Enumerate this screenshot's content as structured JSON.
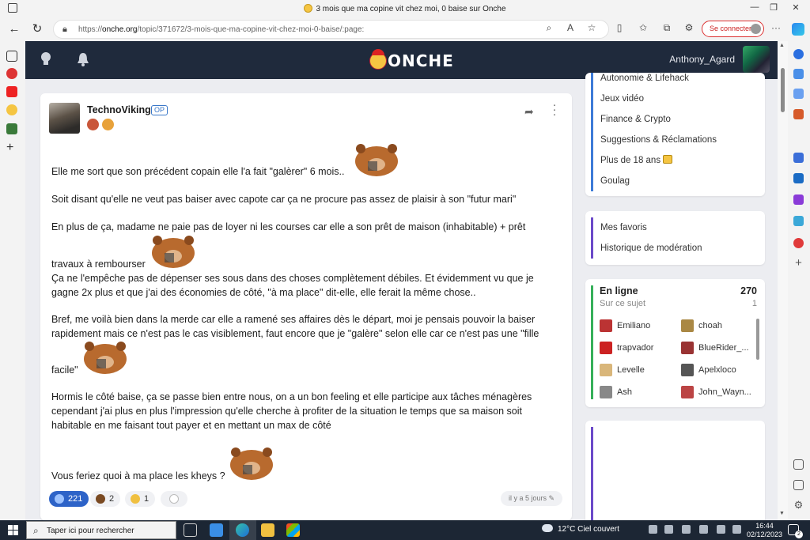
{
  "browser": {
    "window_title": "3 mois que ma copine vit chez moi, 0 baise sur Onche",
    "url_prefix": "https://",
    "url_host": "onche.org",
    "url_path": "/topic/371672/3-mois-que-ma-copine-vit-chez-moi-0-baise/:page:",
    "signin_label": "Se connecter"
  },
  "site": {
    "logo_text": "ONCHE",
    "username": "Anthony_Agard"
  },
  "post": {
    "author": "TechnoViking",
    "op_badge": "OP",
    "paragraphs": [
      "Elle me sort que son précédent copain elle l'a fait \"galèrer\" 6 mois..",
      "Soit disant qu'elle ne veut pas baiser avec capote car ça ne procure pas assez de plaisir à son \"futur mari\"",
      "En plus de ça, madame ne paie pas de loyer ni les courses car elle a son prêt de maison (inhabitable) + prêt",
      "travaux à rembourser",
      "Ça ne l'empêche pas de dépenser ses sous dans des choses complètement débiles. Et évidemment vu que je gagne 2x plus et que j'ai des économies de côté, \"à ma place\" dit-elle, elle ferait la même chose..",
      "Bref, me voilà bien dans la merde car elle a ramené ses affaires dès le départ, moi je pensais pouvoir la baiser rapidement mais ce n'est pas le cas visiblement, faut encore que je \"galère\" selon elle car ce n'est pas une \"fille",
      "facile\"",
      "Hormis le côté baise, ça se passe bien entre nous, on a un bon feeling et elle participe aux tâches ménagères cependant j'ai plus en plus l'impression qu'elle cherche à profiter de la situation le temps que sa maison soit habitable en me faisant tout payer et en mettant un max de côté",
      "Vous feriez quoi à ma place les kheys ?"
    ],
    "reactions": [
      {
        "icon": "thumbs-up-icon",
        "count": "221",
        "active": true
      },
      {
        "icon": "poop-icon",
        "count": "2"
      },
      {
        "icon": "sad-face-icon",
        "count": "1"
      },
      {
        "icon": "add-reaction-icon",
        "count": ""
      }
    ],
    "time_ago": "il y a 5 jours"
  },
  "sidebar": {
    "forums_partial": "Autonomie & Lifehack",
    "forums": [
      "Jeux vidéo",
      "Finance & Crypto",
      "Suggestions & Réclamations",
      "Plus de 18 ans",
      "Goulag"
    ],
    "links": [
      "Mes favoris",
      "Historique de modération"
    ],
    "online": {
      "title": "En ligne",
      "count": "270",
      "sub_label": "Sur ce sujet",
      "sub_count": "1",
      "users": [
        "Emiliano",
        "choah",
        "trapvador",
        "BlueRider_...",
        "Levelle",
        "Apelxloco",
        "Ash",
        "John_Wayn..."
      ]
    }
  },
  "taskbar": {
    "search_placeholder": "Taper ici pour rechercher",
    "weather": "12°C  Ciel couvert",
    "time": "16:44",
    "date": "02/12/2023",
    "notification_count": "2"
  },
  "colors": {
    "header": "#1f2a3c",
    "accent_blue": "#2d63c8",
    "online_green": "#36b05a",
    "link_purple": "#6b49c9"
  }
}
